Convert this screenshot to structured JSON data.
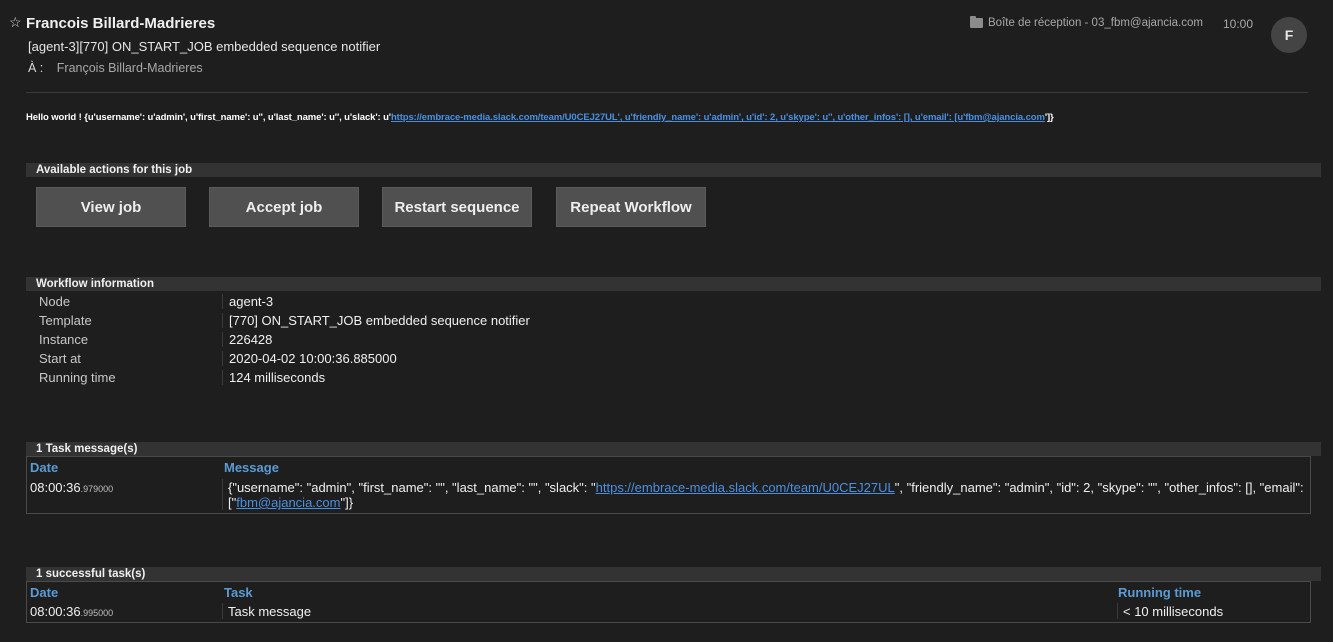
{
  "email": {
    "star": "☆",
    "sender": "Francois Billard-Madrieres",
    "subject": "[agent-3][770] ON_START_JOB embedded sequence notifier",
    "to_label": "À :",
    "recipient": "François Billard-Madrieres",
    "mailbox": "Boîte de réception - 03_fbm@ajancia.com",
    "time": "10:00",
    "avatar_initial": "F"
  },
  "hello": {
    "prefix": "Hello world ! {u'username': u'admin', u'first_name': u'', u'last_name': u'', u'slack': u'",
    "link": "https://embrace-media.slack.com/team/U0CEJ27UL', u'friendly_name': u'admin', u'id': 2, u'skype': u'', u'other_infos': [], u'email': [u'fbm@ajancia.com",
    "suffix": "']}"
  },
  "actions": {
    "title": "Available actions for this job",
    "buttons": [
      "View job",
      "Accept job",
      "Restart sequence",
      "Repeat Workflow"
    ]
  },
  "workflow": {
    "title": "Workflow information",
    "rows": [
      {
        "label": "Node",
        "value": "agent-3"
      },
      {
        "label": "Template",
        "value": "[770] ON_START_JOB embedded sequence notifier"
      },
      {
        "label": "Instance",
        "value": "226428"
      },
      {
        "label": "Start at",
        "value": "2020-04-02 10:00:36.885000"
      },
      {
        "label": "Running time",
        "value": "124 milliseconds"
      }
    ]
  },
  "task_messages": {
    "title": "1 Task message(s)",
    "col_date": "Date",
    "col_message": "Message",
    "row": {
      "date": "08:00:36",
      "date_ms": ".979000",
      "msg_prefix": "{\"username\": \"admin\", \"first_name\": \"\", \"last_name\": \"\", \"slack\": \"",
      "msg_link": "https://embrace-media.slack.com/team/U0CEJ27UL",
      "msg_middle": "\", \"friendly_name\": \"admin\", \"id\": 2, \"skype\": \"\", \"other_infos\": [], \"email\": [\"",
      "msg_email": "fbm@ajancia.com",
      "msg_suffix": "\"]}"
    }
  },
  "successful_tasks": {
    "title": "1 successful task(s)",
    "col_date": "Date",
    "col_task": "Task",
    "col_running": "Running time",
    "row": {
      "date": "08:00:36",
      "date_ms": ".995000",
      "task": "Task message",
      "running": "< 10 milliseconds"
    }
  }
}
